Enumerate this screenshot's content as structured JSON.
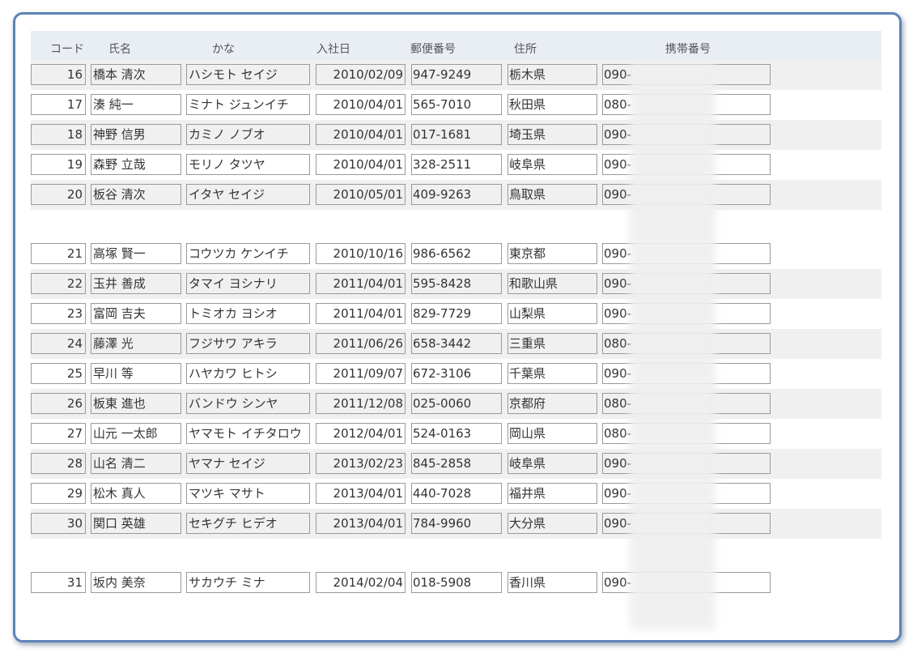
{
  "headers": {
    "code": "コード",
    "name": "氏名",
    "kana": "かな",
    "join_date": "入社日",
    "zip": "郵便番号",
    "address": "住所",
    "mobile": "携帯番号"
  },
  "rows": [
    {
      "code": "16",
      "name": "橋本 清次",
      "kana": "ハシモト セイジ",
      "date": "2010/02/09",
      "zip": "947-9249",
      "addr": "栃木県",
      "tel": "090-"
    },
    {
      "code": "17",
      "name": "湊 純一",
      "kana": "ミナト ジュンイチ",
      "date": "2010/04/01",
      "zip": "565-7010",
      "addr": "秋田県",
      "tel": "080-"
    },
    {
      "code": "18",
      "name": "神野 信男",
      "kana": "カミノ ノブオ",
      "date": "2010/04/01",
      "zip": "017-1681",
      "addr": "埼玉県",
      "tel": "090-"
    },
    {
      "code": "19",
      "name": "森野 立哉",
      "kana": "モリノ タツヤ",
      "date": "2010/04/01",
      "zip": "328-2511",
      "addr": "岐阜県",
      "tel": "090-"
    },
    {
      "code": "20",
      "name": "板谷 清次",
      "kana": "イタヤ セイジ",
      "date": "2010/05/01",
      "zip": "409-9263",
      "addr": "鳥取県",
      "tel": "090-"
    },
    {
      "code": "21",
      "name": "高塚 賢一",
      "kana": "コウツカ ケンイチ",
      "date": "2010/10/16",
      "zip": "986-6562",
      "addr": "東京都",
      "tel": "090-"
    },
    {
      "code": "22",
      "name": "玉井 善成",
      "kana": "タマイ ヨシナリ",
      "date": "2011/04/01",
      "zip": "595-8428",
      "addr": "和歌山県",
      "tel": "090-"
    },
    {
      "code": "23",
      "name": "富岡 吉夫",
      "kana": "トミオカ ヨシオ",
      "date": "2011/04/01",
      "zip": "829-7729",
      "addr": "山梨県",
      "tel": "090-"
    },
    {
      "code": "24",
      "name": "藤澤 光",
      "kana": "フジサワ アキラ",
      "date": "2011/06/26",
      "zip": "658-3442",
      "addr": "三重県",
      "tel": "080-"
    },
    {
      "code": "25",
      "name": "早川 等",
      "kana": "ハヤカワ ヒトシ",
      "date": "2011/09/07",
      "zip": "672-3106",
      "addr": "千葉県",
      "tel": "090-"
    },
    {
      "code": "26",
      "name": "板東 進也",
      "kana": "バンドウ シンヤ",
      "date": "2011/12/08",
      "zip": "025-0060",
      "addr": "京都府",
      "tel": "080-"
    },
    {
      "code": "27",
      "name": "山元 一太郎",
      "kana": "ヤマモト イチタロウ",
      "date": "2012/04/01",
      "zip": "524-0163",
      "addr": "岡山県",
      "tel": "080-"
    },
    {
      "code": "28",
      "name": "山名 清二",
      "kana": "ヤマナ セイジ",
      "date": "2013/02/23",
      "zip": "845-2858",
      "addr": "岐阜県",
      "tel": "090-"
    },
    {
      "code": "29",
      "name": "松木 真人",
      "kana": "マツキ マサト",
      "date": "2013/04/01",
      "zip": "440-7028",
      "addr": "福井県",
      "tel": "090-"
    },
    {
      "code": "30",
      "name": "関口 英雄",
      "kana": "セキグチ ヒデオ",
      "date": "2013/04/01",
      "zip": "784-9960",
      "addr": "大分県",
      "tel": "090-"
    },
    {
      "code": "31",
      "name": "坂内 美奈",
      "kana": "サカウチ ミナ",
      "date": "2014/02/04",
      "zip": "018-5908",
      "addr": "香川県",
      "tel": "090-"
    }
  ]
}
